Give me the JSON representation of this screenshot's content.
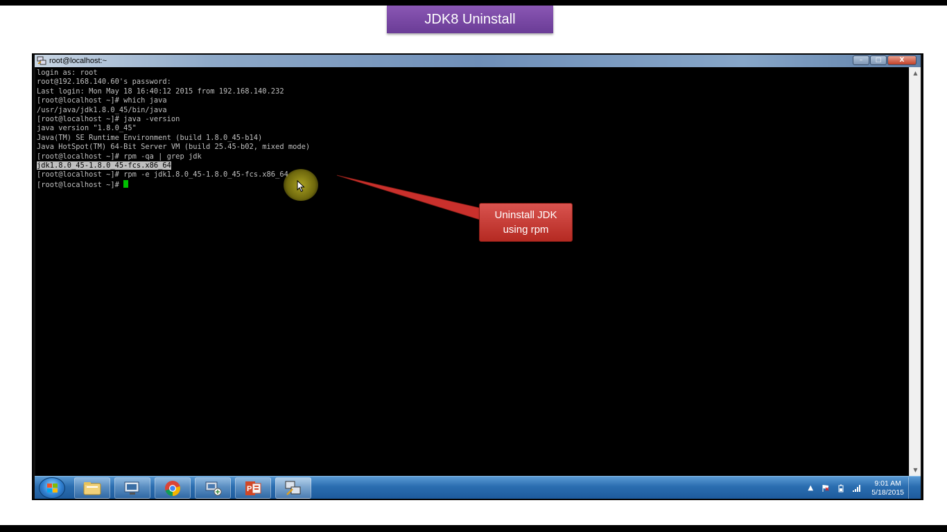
{
  "banner": {
    "title": "JDK8 Uninstall"
  },
  "window": {
    "title": "root@localhost:~",
    "minimize": "–",
    "maximize": "□",
    "close": "X"
  },
  "terminal": {
    "lines": [
      "login as: root",
      "root@192.168.140.60's password:",
      "Last login: Mon May 18 16:40:12 2015 from 192.168.140.232",
      "[root@localhost ~]# which java",
      "/usr/java/jdk1.8.0_45/bin/java",
      "[root@localhost ~]# java -version",
      "java version \"1.8.0_45\"",
      "Java(TM) SE Runtime Environment (build 1.8.0_45-b14)",
      "Java HotSpot(TM) 64-Bit Server VM (build 25.45-b02, mixed mode)",
      "[root@localhost ~]# rpm -qa | grep jdk",
      "jdk1.8.0_45-1.8.0_45-fcs.x86_64",
      "[root@localhost ~]# rpm -e jdk1.8.0_45-1.8.0_45-fcs.x86_64",
      "[root@localhost ~]# "
    ],
    "cursor_color": "#00c000"
  },
  "callout": {
    "line1": "Uninstall JDK",
    "line2": "using rpm",
    "color": "#c9302c"
  },
  "taskbar": {
    "apps": [
      "start-orb-icon",
      "file-explorer-icon",
      "remote-desktop-icon",
      "chrome-icon",
      "network-tool-icon",
      "powerpoint-icon",
      "putty-icon"
    ],
    "tray_arrow": "▲",
    "clock_time": "9:01 AM",
    "clock_date": "5/18/2015"
  }
}
